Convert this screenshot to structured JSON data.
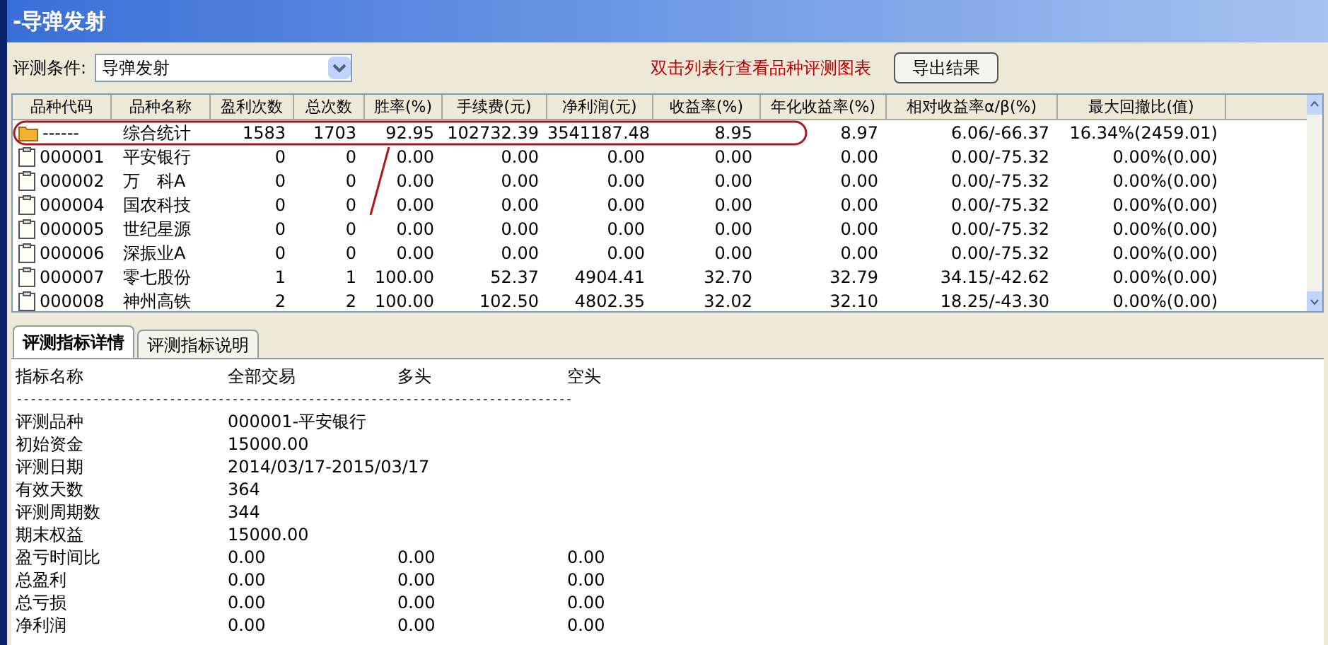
{
  "window": {
    "title": "-导弹发射"
  },
  "toolbar": {
    "condition_label": "评测条件:",
    "condition_value": "导弹发射",
    "hint": "双击列表行查看品种评测图表",
    "export_button": "导出结果"
  },
  "table": {
    "columns": [
      "品种代码",
      "品种名称",
      "盈利次数",
      "总次数",
      "胜率(%)",
      "手续费(元)",
      "净利润(元)",
      "收益率(%)",
      "年化收益率(%)",
      "相对收益率α/β(%)",
      "最大回撤比(值)"
    ],
    "rows": [
      {
        "kind": "summary",
        "cells": [
          "------",
          "综合统计",
          "1583",
          "1703",
          "92.95",
          "102732.39",
          "3541187.48",
          "8.95",
          "8.97",
          "6.06/-66.37",
          "16.34%(2459.01)"
        ]
      },
      {
        "kind": "stock",
        "cells": [
          "000001",
          "平安银行",
          "0",
          "0",
          "0.00",
          "0.00",
          "0.00",
          "0.00",
          "0.00",
          "0.00/-75.32",
          "0.00%(0.00)"
        ]
      },
      {
        "kind": "stock",
        "cells": [
          "000002",
          "万　科A",
          "0",
          "0",
          "0.00",
          "0.00",
          "0.00",
          "0.00",
          "0.00",
          "0.00/-75.32",
          "0.00%(0.00)"
        ]
      },
      {
        "kind": "stock",
        "cells": [
          "000004",
          "国农科技",
          "0",
          "0",
          "0.00",
          "0.00",
          "0.00",
          "0.00",
          "0.00",
          "0.00/-75.32",
          "0.00%(0.00)"
        ]
      },
      {
        "kind": "stock",
        "cells": [
          "000005",
          "世纪星源",
          "0",
          "0",
          "0.00",
          "0.00",
          "0.00",
          "0.00",
          "0.00",
          "0.00/-75.32",
          "0.00%(0.00)"
        ]
      },
      {
        "kind": "stock",
        "cells": [
          "000006",
          "深振业A",
          "0",
          "0",
          "0.00",
          "0.00",
          "0.00",
          "0.00",
          "0.00",
          "0.00/-75.32",
          "0.00%(0.00)"
        ]
      },
      {
        "kind": "stock",
        "cells": [
          "000007",
          "零七股份",
          "1",
          "1",
          "100.00",
          "52.37",
          "4904.41",
          "32.70",
          "32.79",
          "34.15/-42.62",
          "0.00%(0.00)"
        ]
      },
      {
        "kind": "stock",
        "cells": [
          "000008",
          "神州高铁",
          "2",
          "2",
          "100.00",
          "102.50",
          "4802.35",
          "32.02",
          "32.10",
          "18.25/-43.30",
          "0.00%(0.00)"
        ]
      }
    ]
  },
  "tabs": [
    {
      "label": "评测指标详情",
      "selected": true
    },
    {
      "label": "评测指标说明",
      "selected": false
    }
  ],
  "details": {
    "columns": [
      "指标名称",
      "全部交易",
      "多头",
      "空头"
    ],
    "separator": "--------------------------------------------------------------------------------",
    "rows": [
      [
        "评测品种",
        "000001-平安银行"
      ],
      [
        "初始资金",
        "15000.00"
      ],
      [
        "评测日期",
        "2014/03/17-2015/03/17"
      ],
      [
        "有效天数",
        "364"
      ],
      [
        "评测周期数",
        "344"
      ],
      [
        "期末权益",
        "15000.00"
      ],
      [
        "盈亏时间比",
        "0.00",
        "0.00",
        "0.00"
      ],
      [
        "总盈利",
        "0.00",
        "0.00",
        "0.00"
      ],
      [
        "总亏损",
        "0.00",
        "0.00",
        "0.00"
      ],
      [
        "净利润",
        "0.00",
        "0.00",
        "0.00"
      ]
    ]
  }
}
